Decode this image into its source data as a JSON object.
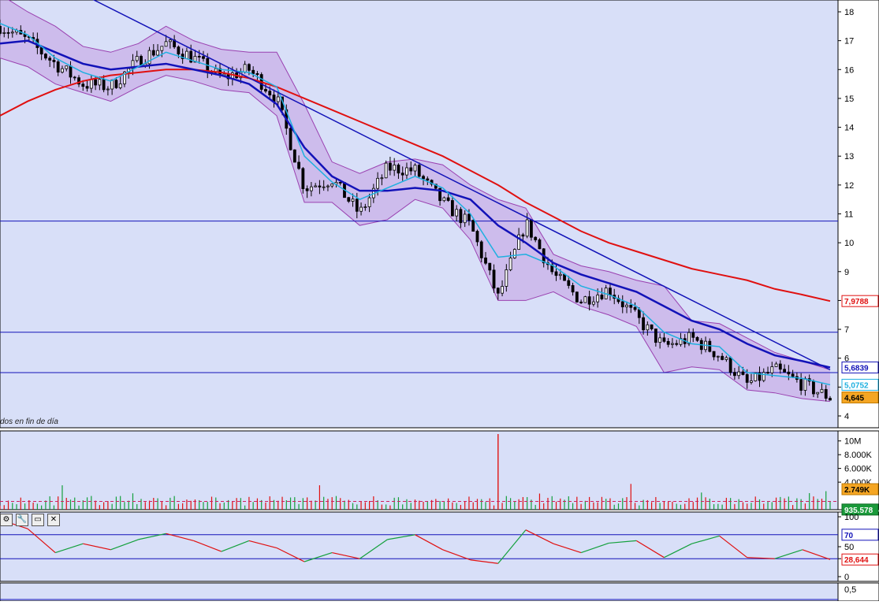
{
  "chart_data": [
    {
      "type": "line",
      "id": "price",
      "caption": "dos en fin de día",
      "y_ticks": [
        "18",
        "17",
        "16",
        "15",
        "14",
        "13",
        "12",
        "11",
        "10",
        "9",
        "8",
        "7",
        "6",
        "5",
        "4"
      ],
      "ylim": [
        3.7,
        18.3
      ],
      "x": [
        0,
        10,
        20,
        30,
        40,
        50,
        60,
        70,
        80,
        90,
        100,
        110,
        120,
        130,
        140,
        150,
        160,
        170,
        180,
        190,
        200,
        210,
        220,
        230,
        240,
        250,
        260,
        270,
        280,
        290,
        300
      ],
      "series": [
        {
          "key": "close",
          "color": "#000000",
          "values": [
            17.5,
            17.0,
            16.2,
            15.5,
            15.4,
            16.3,
            16.9,
            16.4,
            15.7,
            16.0,
            15.0,
            11.9,
            12.2,
            11.0,
            12.6,
            12.5,
            11.4,
            10.6,
            8.1,
            10.7,
            8.9,
            8.0,
            8.4,
            7.4,
            6.4,
            6.7,
            6.1,
            5.1,
            5.6,
            5.1,
            4.64
          ]
        },
        {
          "key": "sma_short",
          "color": "#1fb0e0",
          "values": [
            17.6,
            17.2,
            16.4,
            15.9,
            15.6,
            16.1,
            16.6,
            16.3,
            16.0,
            15.9,
            15.4,
            13.0,
            12.1,
            11.5,
            11.9,
            12.3,
            11.9,
            11.0,
            9.5,
            9.6,
            9.2,
            8.5,
            8.2,
            7.8,
            6.9,
            6.5,
            6.4,
            5.5,
            5.4,
            5.3,
            5.08
          ]
        },
        {
          "key": "sma_mid",
          "color": "#1212b8",
          "values": [
            16.9,
            17.0,
            16.6,
            16.2,
            16.0,
            16.1,
            16.2,
            16.0,
            15.8,
            15.5,
            14.8,
            13.3,
            12.3,
            11.8,
            11.8,
            11.9,
            11.8,
            11.5,
            10.6,
            10.0,
            9.3,
            8.9,
            8.6,
            8.3,
            7.8,
            7.3,
            7.0,
            6.5,
            6.1,
            5.9,
            5.68
          ]
        },
        {
          "key": "sma_long",
          "color": "#e01010",
          "values": [
            14.4,
            14.9,
            15.3,
            15.6,
            15.8,
            15.9,
            16.0,
            16.0,
            15.9,
            15.7,
            15.4,
            15.0,
            14.6,
            14.2,
            13.8,
            13.4,
            13.0,
            12.5,
            12.0,
            11.4,
            10.9,
            10.4,
            10.0,
            9.7,
            9.4,
            9.1,
            8.9,
            8.7,
            8.4,
            8.2,
            7.98
          ]
        },
        {
          "key": "band_upper",
          "color": "#9a40b0",
          "values": [
            18.6,
            18.0,
            17.5,
            16.8,
            16.6,
            16.9,
            17.5,
            17.0,
            16.7,
            16.6,
            16.6,
            14.8,
            12.8,
            12.4,
            12.8,
            12.9,
            12.7,
            12.0,
            11.5,
            11.2,
            9.6,
            9.2,
            9.0,
            8.7,
            8.5,
            7.3,
            7.2,
            6.7,
            6.2,
            5.9,
            5.6
          ]
        },
        {
          "key": "band_lower",
          "color": "#9a40b0",
          "values": [
            16.4,
            16.1,
            15.5,
            15.2,
            14.9,
            15.4,
            15.8,
            15.6,
            15.3,
            15.2,
            14.4,
            11.4,
            11.4,
            10.6,
            10.8,
            11.5,
            11.2,
            10.1,
            8.0,
            8.0,
            8.3,
            7.8,
            7.5,
            7.1,
            5.5,
            5.7,
            5.6,
            4.9,
            4.8,
            4.6,
            4.5
          ]
        }
      ],
      "trendlines": [
        {
          "color": "#1212b8",
          "from": [
            30,
            18.6
          ],
          "to": [
            300,
            5.6
          ]
        }
      ],
      "hlines": [
        {
          "y": 10.75,
          "color": "#1212b8"
        },
        {
          "y": 6.9,
          "color": "#1212b8"
        },
        {
          "y": 5.5,
          "color": "#1212b8"
        }
      ],
      "badges": [
        {
          "label": "7,9788",
          "y": 7.98,
          "text_color": "#e01010",
          "bg": "#ffffff",
          "border": "#e01010"
        },
        {
          "label": "5,6839",
          "y": 5.68,
          "text_color": "#1212b8",
          "bg": "#ffffff",
          "border": "#1212b8"
        },
        {
          "label": "5,0752",
          "y": 5.08,
          "text_color": "#1fb0e0",
          "bg": "#ffffff",
          "border": "#1fb0e0"
        },
        {
          "label": "4,645",
          "y": 4.64,
          "text_color": "#000000",
          "bg": "#f5a623",
          "border": "#c07a00"
        }
      ]
    },
    {
      "type": "bar",
      "id": "volume",
      "y_ticks": [
        "10M",
        "8.000K",
        "6.000K",
        "4.000K"
      ],
      "ylim": [
        0,
        11000
      ],
      "avg_line_color": "#d02060",
      "spike": {
        "x": 180,
        "value": 11000,
        "color": "#e02020"
      },
      "badges": [
        {
          "label": "2.749K",
          "text_color": "#000000",
          "bg": "#f5a623",
          "border": "#c07a00"
        },
        {
          "label": "935.578",
          "text_color": "#ffffff",
          "bg": "#1a9a3a",
          "border": "#0f6a25"
        }
      ]
    },
    {
      "type": "line",
      "id": "rsi",
      "y_ticks": [
        "100",
        "70",
        "50",
        "30",
        "0"
      ],
      "ylim": [
        0,
        100
      ],
      "levels": [
        70,
        30
      ],
      "x": [
        0,
        10,
        20,
        30,
        40,
        50,
        60,
        70,
        80,
        90,
        100,
        110,
        120,
        130,
        140,
        150,
        160,
        170,
        180,
        190,
        200,
        210,
        220,
        230,
        240,
        250,
        260,
        270,
        280,
        290,
        300
      ],
      "values": [
        95,
        80,
        40,
        55,
        45,
        62,
        72,
        60,
        42,
        60,
        48,
        25,
        40,
        30,
        62,
        70,
        45,
        28,
        22,
        78,
        55,
        40,
        56,
        60,
        32,
        55,
        68,
        32,
        30,
        45,
        28.64
      ],
      "colors": {
        "up": "#14a03c",
        "down": "#e01010"
      },
      "badges": [
        {
          "label": "70",
          "text_color": "#1212b8",
          "bg": "#ffffff",
          "border": "#1212b8"
        },
        {
          "label": "28,644",
          "text_color": "#e01010",
          "bg": "#ffffff",
          "border": "#e01010"
        }
      ]
    },
    {
      "type": "area",
      "id": "oscillator",
      "y_ticks": [
        "0,5"
      ]
    }
  ],
  "toolbar": {
    "icons": [
      "settings-icon",
      "wrench-icon",
      "window-icon",
      "close-icon"
    ],
    "glyphs": [
      "⚙",
      "🔧",
      "▭",
      "✕"
    ]
  },
  "colors": {
    "panel_bg": "#d8dff8",
    "axis_bg": "#ffffff",
    "candle_body": "#000000",
    "band_fill": "#c7a5e5"
  }
}
